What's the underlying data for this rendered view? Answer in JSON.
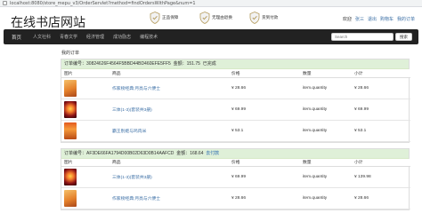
{
  "browser": {
    "url": "localhost:8080/store_mepu_v3/OrderServlet?method=findOrdersWithPage&num=1"
  },
  "header": {
    "title": "在线书店网站",
    "features": [
      {
        "label": "正品保障"
      },
      {
        "label": "无理由退换"
      },
      {
        "label": "货到付款"
      }
    ],
    "user_links": [
      "欢迎",
      "张三",
      "退出",
      "购物车",
      "我的订单"
    ]
  },
  "navbar": {
    "brand": "首页",
    "items": [
      "人文社科",
      "青春文学",
      "经济管理",
      "成功励志",
      "编程技术"
    ],
    "search_placeholder": "Search",
    "search_button": "搜索"
  },
  "main": {
    "section_title": "我的订单",
    "columns": [
      "图片",
      "商品",
      "价格",
      "数量",
      "小计"
    ],
    "orders": [
      {
        "id_label": "订单编号：",
        "id": "30824626F4564F5BBD44BD460EFE5FF5",
        "amount_label": "金额：",
        "amount": "151.75",
        "status": "已完成",
        "items": [
          {
            "name": "作家榜经典:月亮与六便士",
            "price": "¥ 28.66",
            "quantity": "item.quantity",
            "subtotal": "¥ 28.66"
          },
          {
            "name": "三体(1-3)(套装共3册)",
            "price": "¥ 69.99",
            "quantity": "item.quantity",
            "subtotal": "¥ 69.99"
          },
          {
            "name": "霸王别姬与鸡肉米",
            "price": "¥ 53.1",
            "quantity": "item.quantity",
            "subtotal": "¥ 53.1"
          }
        ]
      },
      {
        "id_label": "订单编号：",
        "id": "AF3DE66FA1794D00B02D63D0B14AAFCD",
        "amount_label": "金额：",
        "amount": "168.64",
        "status": "去付款",
        "items": [
          {
            "name": "三体(1-3)(套装共3册)",
            "price": "¥ 69.99",
            "quantity": "item.quantity",
            "subtotal": "¥ 139.98"
          },
          {
            "name": "作家榜经典:月亮与六便士",
            "price": "¥ 28.66",
            "quantity": "item.quantity",
            "subtotal": "¥ 28.66"
          }
        ]
      }
    ]
  },
  "colors": {
    "navbar_bg": "#222222",
    "order_head_bg": "#dff0d8",
    "link": "#3a6ea5"
  }
}
